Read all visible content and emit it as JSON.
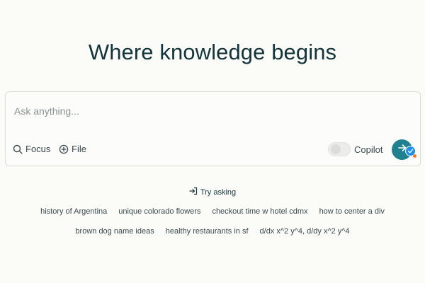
{
  "hero": {
    "title": "Where knowledge begins"
  },
  "ask": {
    "placeholder": "Ask anything...",
    "focus_label": "Focus",
    "file_label": "File",
    "copilot_label": "Copilot",
    "copilot_enabled": false
  },
  "suggestions": {
    "heading": "Try asking",
    "row1": [
      "history of Argentina",
      "unique colorado flowers",
      "checkout time w hotel cdmx",
      "how to center a div"
    ],
    "row2": [
      "brown dog name ideas",
      "healthy restaurants in sf",
      "d/dx x^2 y^4, d/dy x^2 y^4"
    ]
  },
  "colors": {
    "accent": "#20808d",
    "text": "#13343b",
    "muted": "#8a9294",
    "background": "#fbfbf8",
    "badge": "#1e90e6",
    "badge_dot": "#f07a2e"
  },
  "icons": {
    "focus": "search-icon",
    "file": "plus-circle-icon",
    "submit": "arrow-right-icon",
    "badge": "check-badge-icon",
    "try_asking": "arrow-into-bracket-icon"
  }
}
